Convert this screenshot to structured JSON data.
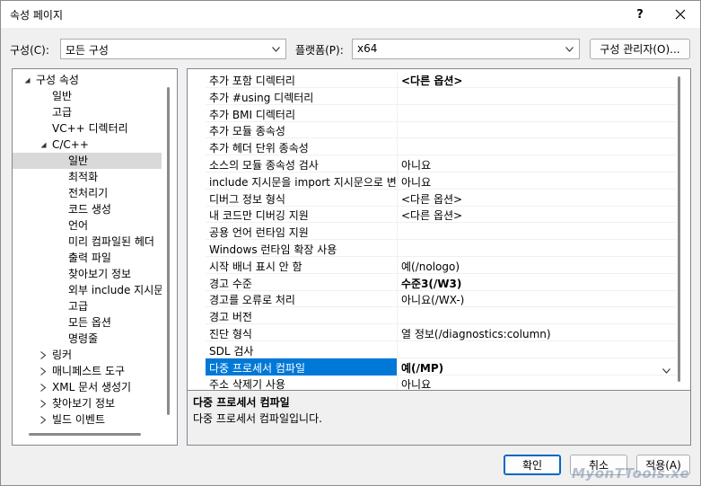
{
  "window": {
    "title": "속성 페이지",
    "help_label": "?"
  },
  "config": {
    "label": "구성(C):",
    "value": "모든 구성"
  },
  "platform": {
    "label": "플랫폼(P):",
    "value": "x64"
  },
  "config_manager_label": "구성 관리자(O)...",
  "tree": [
    {
      "label": "구성 속성",
      "expander": "open"
    },
    {
      "label": "일반"
    },
    {
      "label": "고급"
    },
    {
      "label": "VC++ 디렉터리"
    },
    {
      "label": "C/C++",
      "expander": "open"
    },
    {
      "label": "일반",
      "selected": true
    },
    {
      "label": "최적화"
    },
    {
      "label": "전처리기"
    },
    {
      "label": "코드 생성"
    },
    {
      "label": "언어"
    },
    {
      "label": "미리 컴파일된 헤더"
    },
    {
      "label": "출력 파일"
    },
    {
      "label": "찾아보기 정보"
    },
    {
      "label": "외부 include 지시문"
    },
    {
      "label": "고급"
    },
    {
      "label": "모든 옵션"
    },
    {
      "label": "명령줄"
    },
    {
      "label": "링커",
      "expander": "closed"
    },
    {
      "label": "매니페스트 도구",
      "expander": "closed"
    },
    {
      "label": "XML 문서 생성기",
      "expander": "closed"
    },
    {
      "label": "찾아보기 정보",
      "expander": "closed"
    },
    {
      "label": "빌드 이벤트",
      "expander": "closed"
    }
  ],
  "properties": [
    {
      "name": "추가 포함 디렉터리",
      "value": "<다른 옵션>",
      "bold": true
    },
    {
      "name": "추가 #using 디렉터리",
      "value": ""
    },
    {
      "name": "추가 BMI 디렉터리",
      "value": ""
    },
    {
      "name": "추가 모듈 종속성",
      "value": ""
    },
    {
      "name": "추가 헤더 단위 종속성",
      "value": ""
    },
    {
      "name": "소스의 모듈 종속성 검사",
      "value": "아니요"
    },
    {
      "name": "include 지시문을 import 지시문으로 변",
      "value": "아니요"
    },
    {
      "name": "디버그 정보 형식",
      "value": "<다른 옵션>"
    },
    {
      "name": "내 코드만 디버깅 지원",
      "value": "<다른 옵션>"
    },
    {
      "name": "공용 언어 런타임 지원",
      "value": ""
    },
    {
      "name": "Windows 런타임 확장 사용",
      "value": ""
    },
    {
      "name": "시작 배너 표시 안 함",
      "value": "예(/nologo)"
    },
    {
      "name": "경고 수준",
      "value": "수준3(/W3)",
      "bold": true
    },
    {
      "name": "경고를 오류로 처리",
      "value": "아니요(/WX-)"
    },
    {
      "name": "경고 버전",
      "value": ""
    },
    {
      "name": "진단 형식",
      "value": "열 정보(/diagnostics:column)"
    },
    {
      "name": "SDL 검사",
      "value": ""
    },
    {
      "name": "다중 프로세서 컴파일",
      "value": "예(/MP)",
      "bold": true,
      "selected": true
    },
    {
      "name": "주소 삭제기 사용",
      "value": "아니요"
    }
  ],
  "description": {
    "title": "다중 프로세서 컴파일",
    "text": "다중 프로세서 컴파일입니다."
  },
  "buttons": {
    "ok": "확인",
    "cancel": "취소",
    "apply": "적용(A)"
  },
  "watermark": "MyonTTools.xe",
  "colors": {
    "selection": "#0078d7",
    "accent_border": "#0067c0",
    "tree_selection": "#d9d9d9"
  }
}
